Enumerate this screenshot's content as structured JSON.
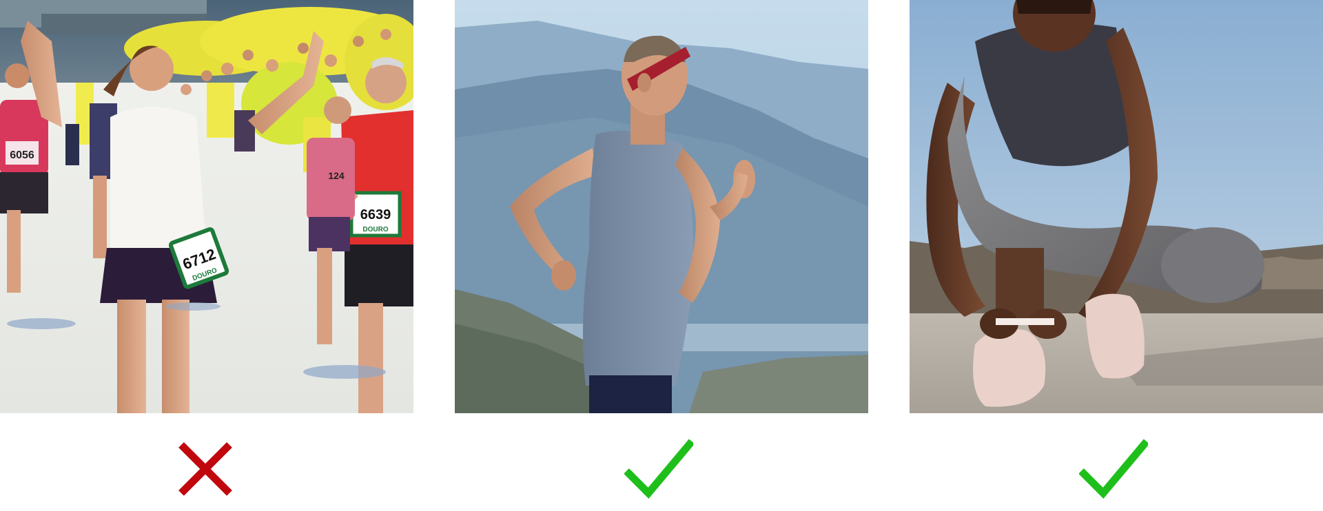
{
  "panels": [
    {
      "id": "marathon-crowd",
      "verdict": "cross",
      "bibs": [
        "6056",
        "6712",
        "6639",
        "124"
      ],
      "bib_captions": [
        "DOURO",
        "DOURO",
        "DOURO"
      ]
    },
    {
      "id": "mountain-runner",
      "verdict": "check"
    },
    {
      "id": "shoe-tying",
      "verdict": "check"
    }
  ],
  "colors": {
    "cross": "#c0070d",
    "check": "#1fbf1b",
    "background": "#ffffff"
  }
}
